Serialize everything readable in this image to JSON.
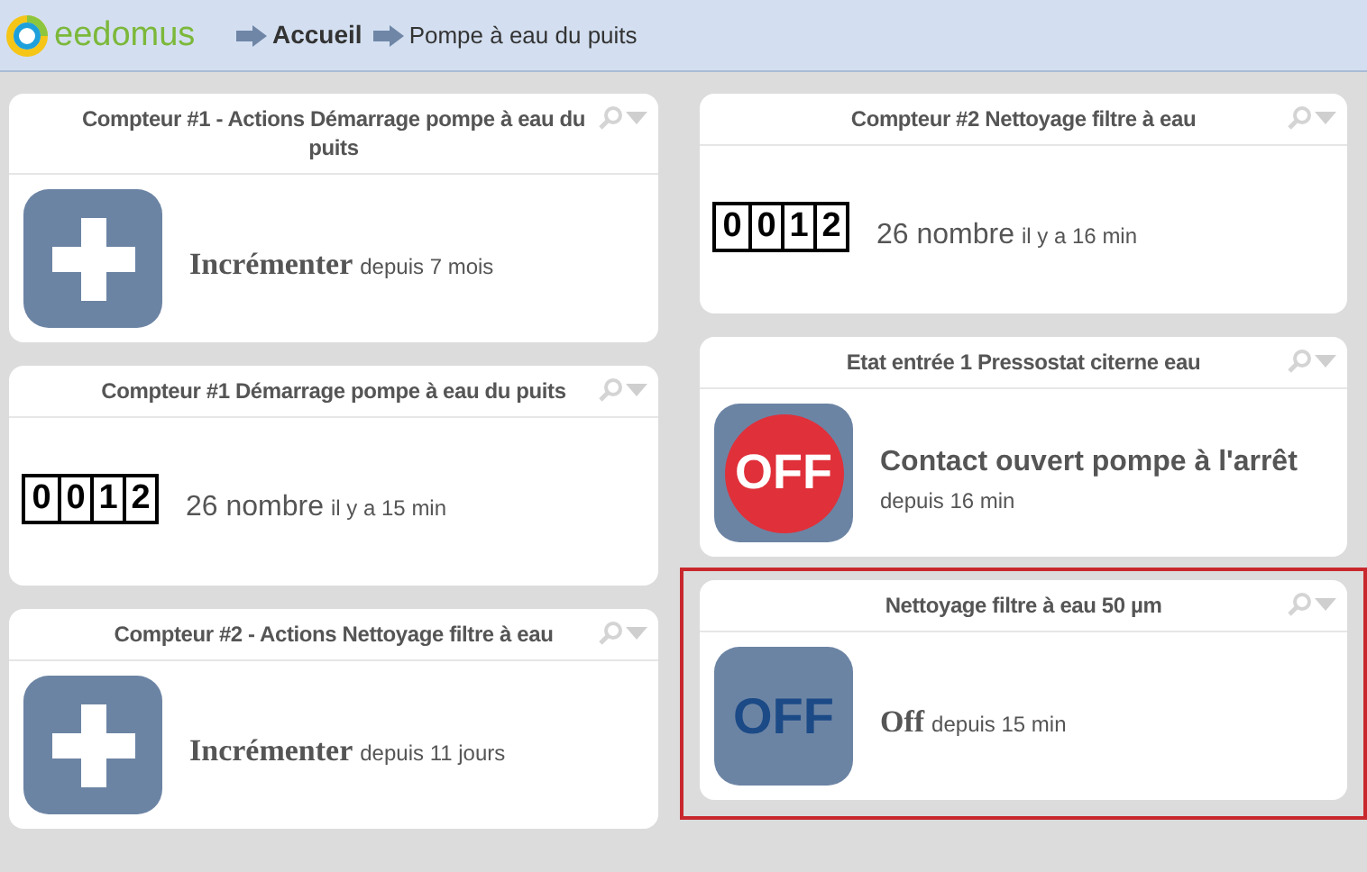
{
  "header": {
    "logo": "eedomus",
    "breadcrumb": [
      {
        "label": "Accueil",
        "current": false
      },
      {
        "label": "Pompe à eau du puits",
        "current": true
      }
    ]
  },
  "columns": [
    {
      "cards": [
        {
          "title": "Compteur #1 - Actions Démarrage pompe à eau du puits",
          "kind": "plus",
          "value": "Incrémenter",
          "since": "depuis 7 mois",
          "selected": false
        },
        {
          "title": "Compteur #1 Démarrage pompe à eau du puits",
          "kind": "counter",
          "digits": [
            "0",
            "0",
            "1",
            "2"
          ],
          "value": "26 nombre",
          "since": "il y a 15 min",
          "selected": false
        },
        {
          "title": "Compteur #2 - Actions Nettoyage filtre à eau",
          "kind": "plus",
          "value": "Incrémenter",
          "since": "depuis 11 jours",
          "selected": false
        }
      ]
    },
    {
      "cards": [
        {
          "title": "Compteur #2 Nettoyage filtre à eau",
          "kind": "counter",
          "digits": [
            "0",
            "0",
            "1",
            "2"
          ],
          "value": "26 nombre",
          "since": "il y a 16 min",
          "selected": false
        },
        {
          "title": "Etat entrée 1 Pressostat citerne eau",
          "kind": "off_red",
          "icon_text": "OFF",
          "value": "Contact ouvert pompe à l'arrêt",
          "since": "depuis 16 min",
          "selected": false
        },
        {
          "title": "Nettoyage filtre à eau 50 µm",
          "kind": "off_blue",
          "icon_text": "OFF",
          "value": "Off",
          "since": "depuis 15 min",
          "selected": true
        }
      ]
    }
  ]
}
